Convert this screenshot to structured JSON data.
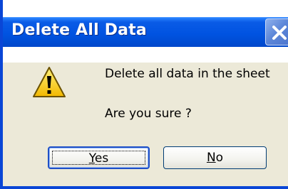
{
  "window": {
    "title": "Delete All Data",
    "close_icon": "close-icon"
  },
  "message": {
    "icon": "warning-icon",
    "line1": "Delete all data in the sheet",
    "line2": "Are you sure ?"
  },
  "buttons": {
    "yes": {
      "mnemonic": "Y",
      "rest": "es"
    },
    "no": {
      "mnemonic": "N",
      "rest": "o"
    }
  },
  "colors": {
    "titlebar": "#0053e1",
    "dialog_bg": "#ece9d8",
    "warning_fill": "#ffd400"
  }
}
